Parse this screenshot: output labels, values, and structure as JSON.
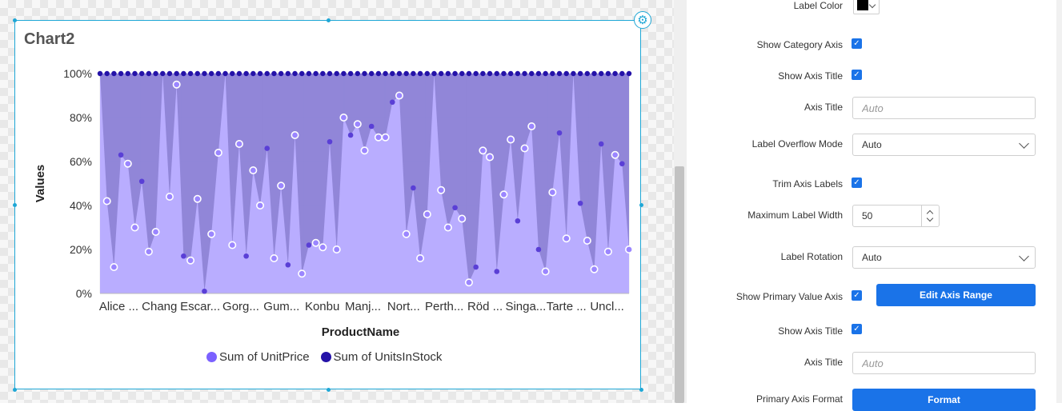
{
  "chart": {
    "title": "Chart2",
    "settings_icon": "gear-icon"
  },
  "chart_data": {
    "type": "area",
    "stacking": "100%",
    "xlabel": "ProductName",
    "ylabel": "Values",
    "ylim": [
      0,
      100
    ],
    "yticks": [
      "0%",
      "20%",
      "40%",
      "60%",
      "80%",
      "100%"
    ],
    "xtick_labels": [
      "Alice ...",
      "Chang",
      "Escar...",
      "Gorg...",
      "Gum...",
      "Konbu",
      "Manj...",
      "Nort...",
      "Perth...",
      "Röd ...",
      "Singa...",
      "Tarte ...",
      "Uncl..."
    ],
    "grid": true,
    "legend_position": "bottom",
    "series": [
      {
        "name": "Sum of UnitPrice",
        "color": "#7b61ff",
        "values": [
          100,
          42,
          12,
          63,
          59,
          30,
          51,
          19,
          28,
          100,
          44,
          95,
          17,
          15,
          43,
          1,
          27,
          64,
          100,
          22,
          68,
          17,
          56,
          40,
          66,
          16,
          49,
          13,
          72,
          9,
          22,
          23,
          21,
          69,
          20,
          80,
          72,
          77,
          65,
          76,
          71,
          71,
          87,
          90,
          27,
          48,
          16,
          36,
          100,
          47,
          30,
          39,
          34,
          5,
          12,
          65,
          62,
          10,
          45,
          70,
          33,
          66,
          76,
          20,
          10,
          46,
          73,
          25,
          100,
          41,
          24,
          11,
          68,
          19,
          63,
          59,
          20
        ]
      },
      {
        "name": "Sum of UnitsInStock",
        "color": "#2412a8",
        "values": [
          100,
          100,
          100,
          100,
          100,
          100,
          100,
          100,
          100,
          100,
          100,
          100,
          100,
          100,
          100,
          100,
          100,
          100,
          100,
          100,
          100,
          100,
          100,
          100,
          100,
          100,
          100,
          100,
          100,
          100,
          100,
          100,
          100,
          100,
          100,
          100,
          100,
          100,
          100,
          100,
          100,
          100,
          100,
          100,
          100,
          100,
          100,
          100,
          100,
          100,
          100,
          100,
          100,
          100,
          100,
          100,
          100,
          100,
          100,
          100,
          100,
          100,
          100,
          100,
          100,
          100,
          100,
          100,
          100,
          100,
          100,
          100,
          100,
          100,
          100,
          100,
          100
        ]
      }
    ]
  },
  "panel": {
    "label_color": "Label Color",
    "show_category_axis": "Show Category Axis",
    "show_axis_title_1": "Show Axis Title",
    "axis_title_1": "Axis Title",
    "axis_title_placeholder": "Auto",
    "label_overflow_mode": "Label Overflow Mode",
    "label_overflow_value": "Auto",
    "trim_axis_labels": "Trim Axis Labels",
    "max_label_width": "Maximum Label Width",
    "max_label_width_value": "50",
    "label_rotation": "Label Rotation",
    "label_rotation_value": "Auto",
    "show_primary_value_axis": "Show Primary Value Axis",
    "edit_axis_range": "Edit Axis Range",
    "show_axis_title_2": "Show Axis Title",
    "axis_title_2": "Axis Title",
    "primary_axis_format": "Primary Axis Format",
    "format_button": "Format"
  }
}
